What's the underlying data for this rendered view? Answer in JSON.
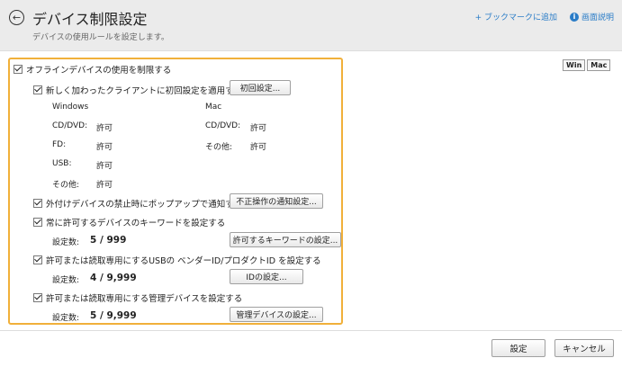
{
  "header": {
    "title": "デバイス制限設定",
    "subtitle": "デバイスの使用ルールを設定します。",
    "bookmark_link": "+ ブックマークに追加",
    "help_link": "画面説明"
  },
  "os_toggle": {
    "win": "Win",
    "mac": "Mac"
  },
  "offline_restrict": {
    "label": "オフラインデバイスの使用を制限する",
    "checked": true
  },
  "initial_setting": {
    "label": "新しく加わったクライアントに初回設定を適用する",
    "checked": true,
    "button": "初回設定..."
  },
  "windows": {
    "heading": "Windows",
    "rows": [
      {
        "name": "CD/DVD:",
        "value": "許可"
      },
      {
        "name": "FD:",
        "value": "許可"
      },
      {
        "name": "USB:",
        "value": "許可"
      },
      {
        "name": "その他:",
        "value": "許可"
      }
    ]
  },
  "mac": {
    "heading": "Mac",
    "rows": [
      {
        "name": "CD/DVD:",
        "value": "許可"
      },
      {
        "name": "その他:",
        "value": "許可"
      }
    ]
  },
  "popup_notify": {
    "label": "外付けデバイスの禁止時にポップアップで通知する",
    "checked": true,
    "button": "不正操作の通知設定..."
  },
  "keyword": {
    "label": "常に許可するデバイスのキーワードを設定する",
    "checked": true,
    "count_label": "設定数:",
    "count": "5 / 999",
    "button": "許可するキーワードの設定..."
  },
  "usb_id": {
    "label": "許可または読取専用にするUSBの ベンダーID/プロダクトID を設定する",
    "checked": true,
    "count_label": "設定数:",
    "count": "4 / 9,999",
    "button": "IDの設定..."
  },
  "mgmt_device": {
    "label": "許可または読取専用にする管理デバイスを設定する",
    "checked": true,
    "count_label": "設定数:",
    "count": "5 / 9,999",
    "button": "管理デバイスの設定..."
  },
  "footer": {
    "ok": "設定",
    "cancel": "キャンセル"
  }
}
